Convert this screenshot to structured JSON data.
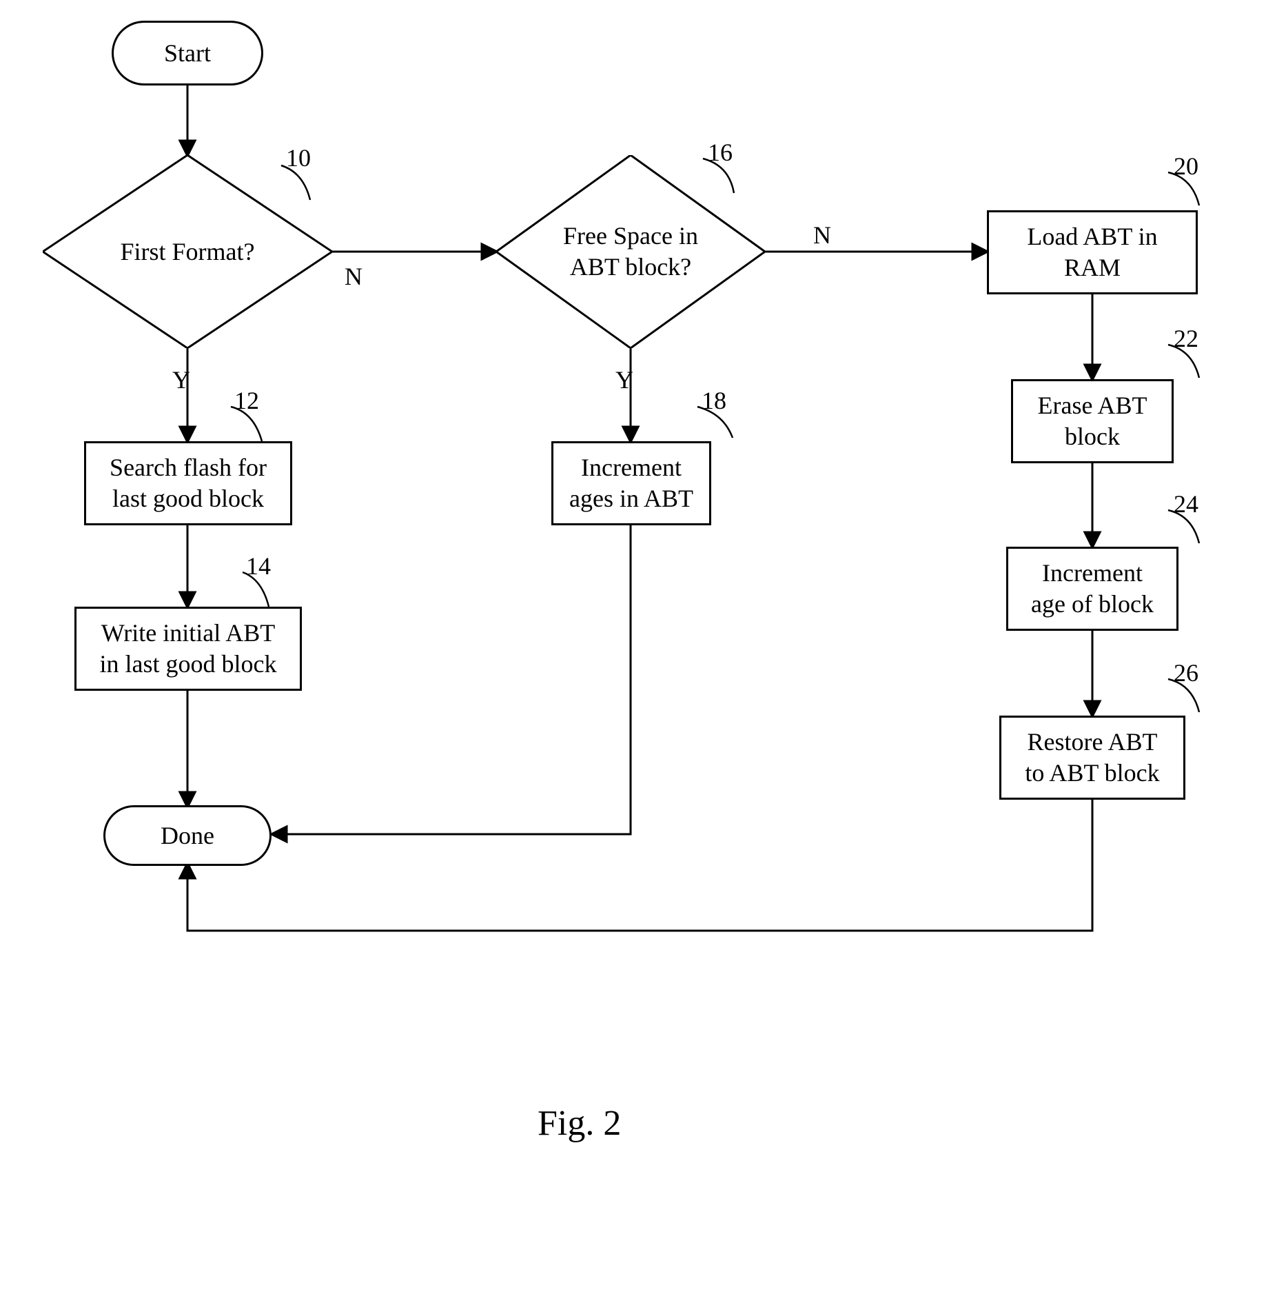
{
  "nodes": {
    "start": "Start",
    "done": "Done",
    "d10": "First Format?",
    "d16": "Free Space in\nABT block?",
    "p12": "Search flash for\nlast good block",
    "p14": "Write initial ABT\nin last good block",
    "p18": "Increment\nages in ABT",
    "p20": "Load ABT in\nRAM",
    "p22": "Erase ABT\nblock",
    "p24": "Increment\nage of block",
    "p26": "Restore ABT\nto ABT block"
  },
  "refs": {
    "r10": "10",
    "r12": "12",
    "r14": "14",
    "r16": "16",
    "r18": "18",
    "r20": "20",
    "r22": "22",
    "r24": "24",
    "r26": "26"
  },
  "edges": {
    "y": "Y",
    "n": "N"
  },
  "caption": "Fig. 2"
}
